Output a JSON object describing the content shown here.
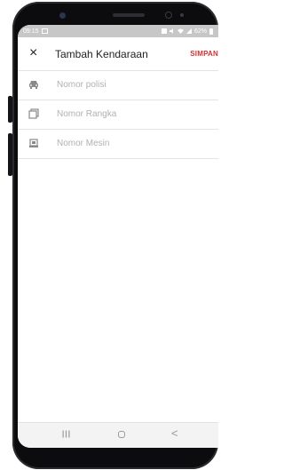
{
  "status_bar": {
    "time": "09:15",
    "battery": "62%"
  },
  "app_bar": {
    "close_glyph": "×",
    "title": "Tambah Kendaraan",
    "save_label": "SIMPAN"
  },
  "form": {
    "fields": [
      {
        "placeholder": "Nomor polisi",
        "icon": "car-icon"
      },
      {
        "placeholder": "Nomor Rangka",
        "icon": "frame-icon"
      },
      {
        "placeholder": "Nomor Mesin",
        "icon": "engine-icon"
      }
    ]
  },
  "nav_bar": {
    "back_glyph": "<"
  },
  "colors": {
    "accent": "#d32f2f",
    "status_bar": "#c7c7c7",
    "placeholder": "#b1b1b1"
  }
}
